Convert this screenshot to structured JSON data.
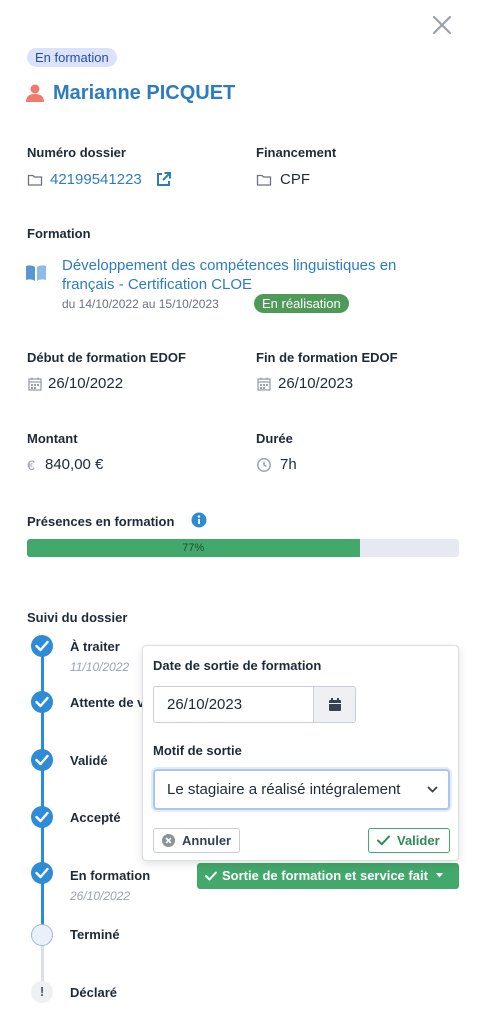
{
  "header": {
    "status_badge": "En formation",
    "trainee_name": "Marianne PICQUET"
  },
  "dossier": {
    "numero_label": "Numéro dossier",
    "numero_value": "42199541223",
    "financement_label": "Financement",
    "financement_value": "CPF"
  },
  "formation": {
    "label": "Formation",
    "title": "Développement des compétences linguistiques en français - Certification CLOE",
    "dates": "du 14/10/2022 au 15/10/2023",
    "status_badge": "En réalisation",
    "debut_label": "Début de formation EDOF",
    "debut_value": "26/10/2022",
    "fin_label": "Fin de formation EDOF",
    "fin_value": "26/10/2023",
    "montant_label": "Montant",
    "montant_value": "840,00 €",
    "duree_label": "Durée",
    "duree_value": "7h"
  },
  "presences": {
    "label": "Présences en formation",
    "percent": 77,
    "percent_text": "77%"
  },
  "suivi": {
    "label": "Suivi du dossier",
    "steps": [
      {
        "label": "À traiter",
        "date": "11/10/2022",
        "state": "done"
      },
      {
        "label": "Attente de validation",
        "date": "",
        "state": "done"
      },
      {
        "label": "Validé",
        "date": "",
        "state": "done"
      },
      {
        "label": "Accepté",
        "date": "",
        "state": "done"
      },
      {
        "label": "En formation",
        "date": "26/10/2022",
        "state": "done"
      },
      {
        "label": "Terminé",
        "date": "",
        "state": "pending"
      },
      {
        "label": "Déclaré",
        "date": "",
        "state": "warning"
      }
    ],
    "warning_glyph": "!",
    "action_button": "Sortie de formation et service fait"
  },
  "popover": {
    "date_label": "Date de sortie de formation",
    "date_value": "26/10/2023",
    "motif_label": "Motif de sortie",
    "motif_value": "Le stagiaire a réalisé intégralement",
    "cancel_label": "Annuler",
    "validate_label": "Valider"
  },
  "colors": {
    "accent": "#2d7cc1",
    "success": "#43a86b",
    "timeline": "#2e8bd6"
  }
}
